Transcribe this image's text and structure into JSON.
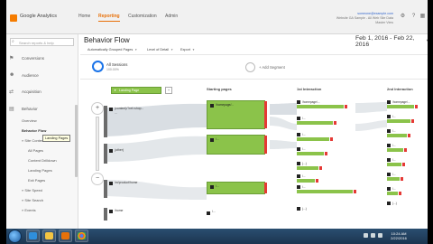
{
  "header": {
    "app_title": "Google Analytics",
    "nav": [
      "Home",
      "Reporting",
      "Customization",
      "Admin"
    ],
    "active_nav": "Reporting",
    "account_email": "someone@example.com",
    "account_line2": "Website GA Sample - All Web Site Data",
    "account_line3": "Master View",
    "accent": "#e8710a"
  },
  "sidebar": {
    "search_placeholder": "Search reports & help",
    "items": [
      {
        "label": "Conversions",
        "icon": "flag-icon"
      },
      {
        "label": "Audience",
        "icon": "person-icon"
      },
      {
        "label": "Acquisition",
        "icon": "arrows-icon"
      },
      {
        "label": "Behavior",
        "icon": "behavior-icon"
      }
    ],
    "sub_items": [
      "Overview",
      "Behavior Flow",
      "» Site Content",
      "All Pages",
      "Content Drilldown",
      "Landing Pages",
      "Exit Pages",
      "» Site Speed",
      "» Site Search",
      "» Events"
    ],
    "tooltip": "Landing Pages"
  },
  "main": {
    "title": "Behavior Flow",
    "date_range": "Feb 1, 2016 - Feb 22, 2016",
    "filters": [
      "Automatically Grouped Pages",
      "Level of Detail",
      "Export"
    ],
    "segment_all": "All Sessions",
    "segment_all_sub": "100.00%",
    "segment_add": "+ Add Segment"
  },
  "flow": {
    "dimension_label": "Landing Page",
    "columns": [
      {
        "title": "Starting pages",
        "sub": "",
        "key": "c1"
      },
      {
        "title": "1st Interaction",
        "sub": "",
        "key": "c2"
      },
      {
        "title": "2nd Interaction",
        "sub": "",
        "key": "c3"
      }
    ],
    "landing_nodes": [
      {
        "label": "(content)/?ref=shop...",
        "value": "..."
      },
      {
        "label": "(other)",
        "value": ""
      },
      {
        "label": "/m/product/home",
        "value": ""
      },
      {
        "label": "/home",
        "value": ""
      }
    ],
    "starting_nodes": [
      {
        "label": "/homepage/...",
        "value": ""
      },
      {
        "label": "/...",
        "value": ""
      },
      {
        "label": "/...",
        "value": ""
      }
    ],
    "first_nodes": [
      "/homepage/...",
      "/...",
      "/...",
      "/...",
      "(...)",
      "/...",
      "/...",
      "(...)"
    ],
    "second_nodes": [
      "/homepage/...",
      "/...",
      "/...",
      "/...",
      "/...",
      "/...",
      "/...",
      "(...)"
    ]
  },
  "taskbar": {
    "time": "10:24 AM",
    "date": "2/22/2016"
  }
}
